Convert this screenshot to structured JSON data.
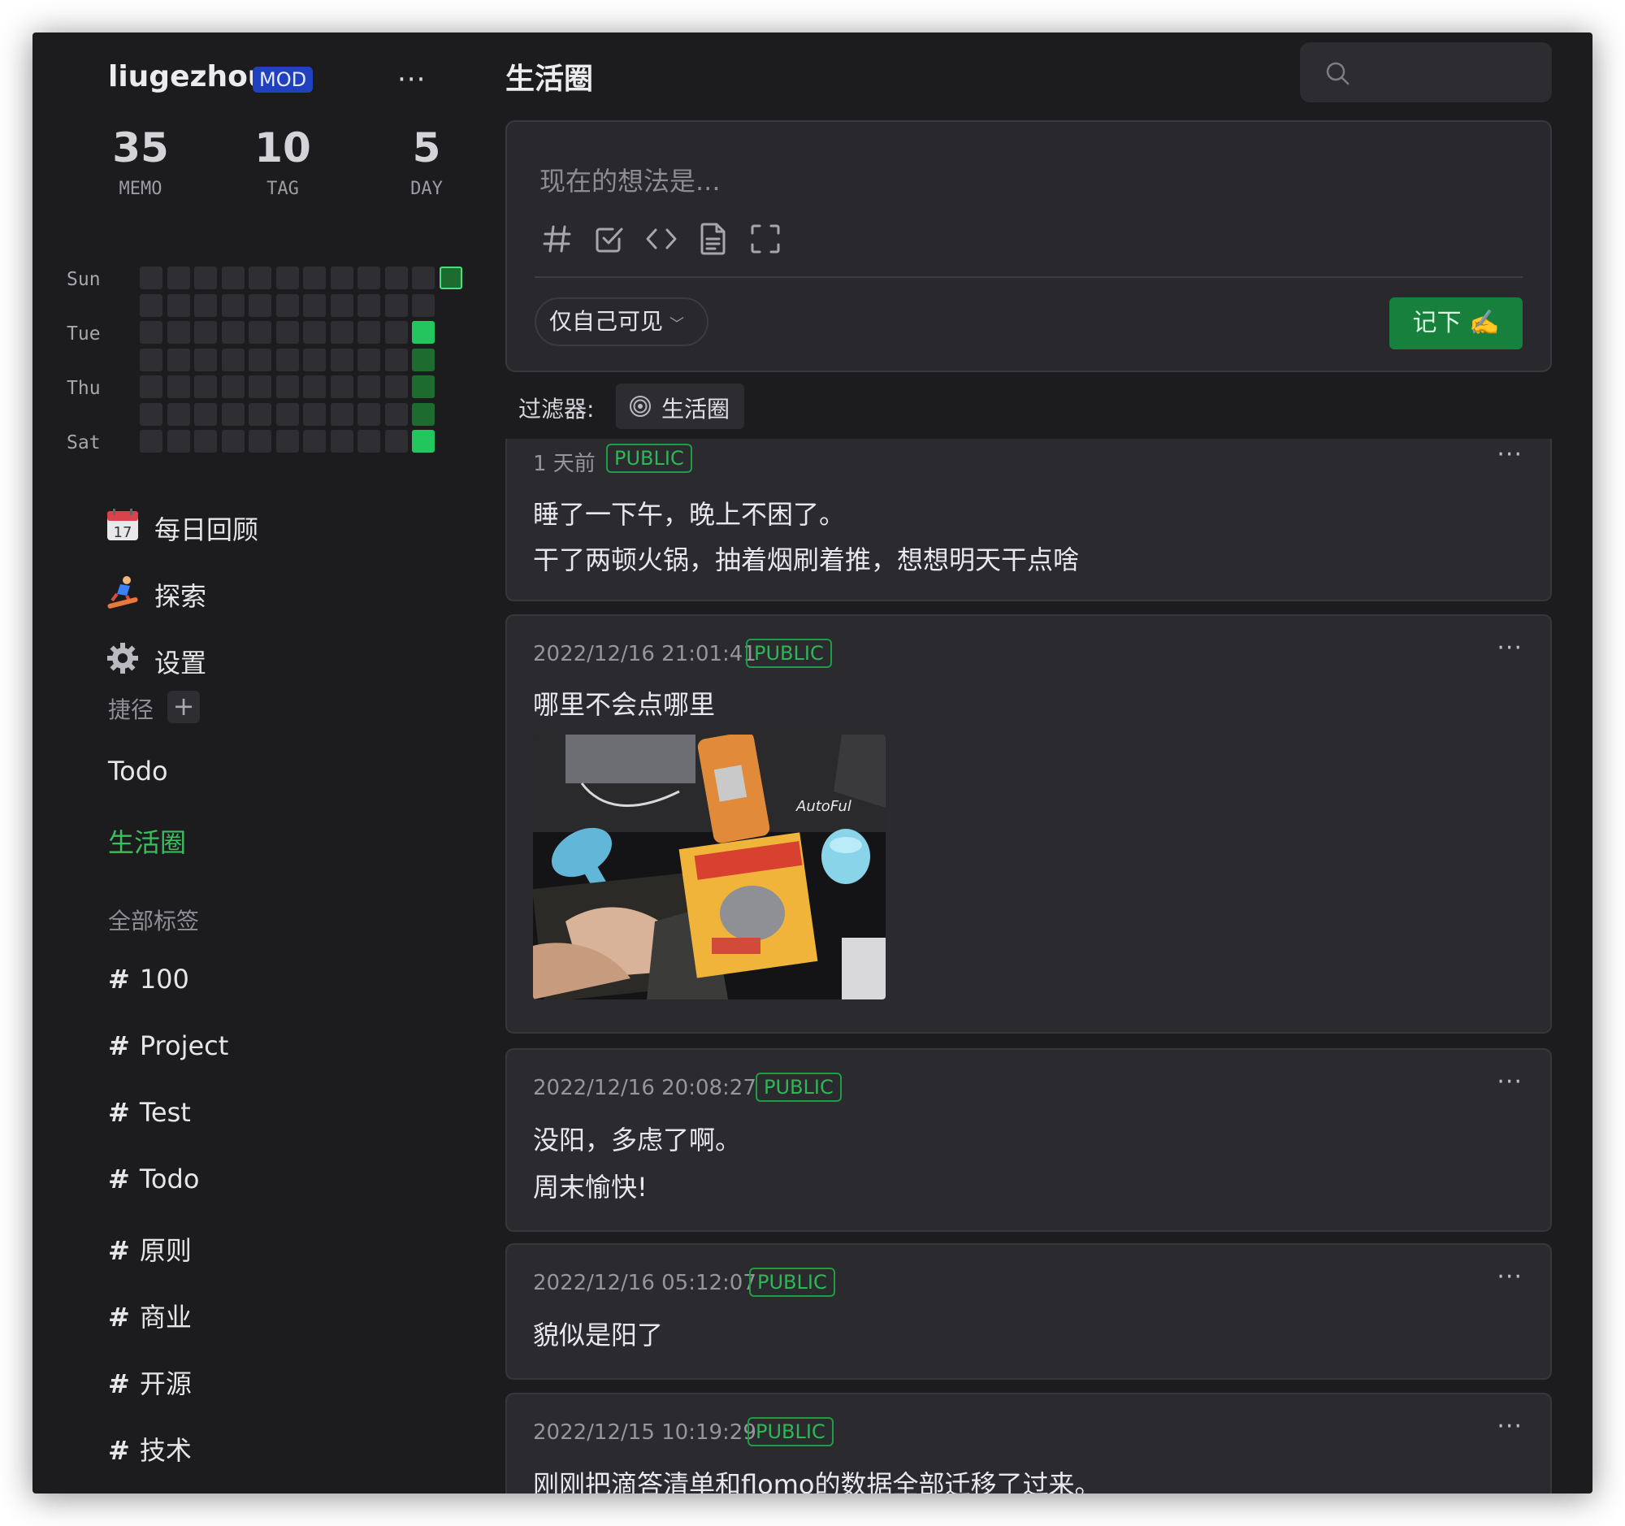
{
  "user": {
    "name": "liugezhou",
    "badge": "MOD"
  },
  "stats": [
    {
      "value": "35",
      "label": "MEMO"
    },
    {
      "value": "10",
      "label": "TAG"
    },
    {
      "value": "5",
      "label": "DAY"
    }
  ],
  "heatmap": {
    "day_labels": [
      "Sun",
      "Tue",
      "Thu",
      "Sat"
    ],
    "weeks": 12,
    "active_cells": [
      {
        "week": 11,
        "day": 0,
        "level": "today"
      },
      {
        "week": 10,
        "day": 2,
        "level": 2
      },
      {
        "week": 10,
        "day": 3,
        "level": 1
      },
      {
        "week": 10,
        "day": 4,
        "level": 1
      },
      {
        "week": 10,
        "day": 5,
        "level": 1
      },
      {
        "week": 10,
        "day": 6,
        "level": 2
      }
    ]
  },
  "nav": [
    {
      "label": "每日回顾",
      "icon": "calendar-icon"
    },
    {
      "label": "探索",
      "icon": "snowboarder-icon"
    },
    {
      "label": "设置",
      "icon": "gear-icon"
    }
  ],
  "shortcuts": {
    "label": "捷径",
    "add": "+",
    "items": [
      {
        "label": "Todo",
        "active": false
      },
      {
        "label": "生活圈",
        "active": true
      }
    ]
  },
  "tags": {
    "label": "全部标签",
    "hash": "#",
    "items": [
      "100",
      "Project",
      "Test",
      "Todo",
      "原则",
      "商业",
      "开源",
      "技术"
    ]
  },
  "header": {
    "title": "生活圈",
    "search_placeholder": ""
  },
  "editor": {
    "placeholder": "现在的想法是...",
    "tools": [
      "hash-icon",
      "checkbox-icon",
      "code-icon",
      "document-icon",
      "fullscreen-icon"
    ],
    "visibility": "仅自己可见",
    "chevron": "﹀",
    "save_label": "记下 ✍️"
  },
  "filter": {
    "label": "过滤器:",
    "chip": "生活圈"
  },
  "memos": [
    {
      "time": "1 天前",
      "visibility": "PUBLIC",
      "lines": [
        "睡了一下午，晚上不困了。",
        "干了两顿火锅，抽着烟刷着推，想想明天干点啥"
      ]
    },
    {
      "time": "2022/12/16 21:01:41",
      "visibility": "PUBLIC",
      "lines": [
        "哪里不会点哪里"
      ],
      "image": "desk-photo",
      "image_text": "AutoFul"
    },
    {
      "time": "2022/12/16 20:08:27",
      "visibility": "PUBLIC",
      "lines": [
        "没阳，多虑了啊。",
        "周末愉快!"
      ]
    },
    {
      "time": "2022/12/16 05:12:07",
      "visibility": "PUBLIC",
      "lines": [
        "貌似是阳了"
      ]
    },
    {
      "time": "2022/12/15 10:19:29",
      "visibility": "PUBLIC",
      "lines": [
        "刚刚把滴答清单和flomo的数据全部迁移了过来。"
      ]
    }
  ],
  "more_glyph": "···",
  "colors": {
    "accent": "#22c55e",
    "public_border": "#1f9d45",
    "badge": "#2041bd",
    "save": "#16803c"
  }
}
